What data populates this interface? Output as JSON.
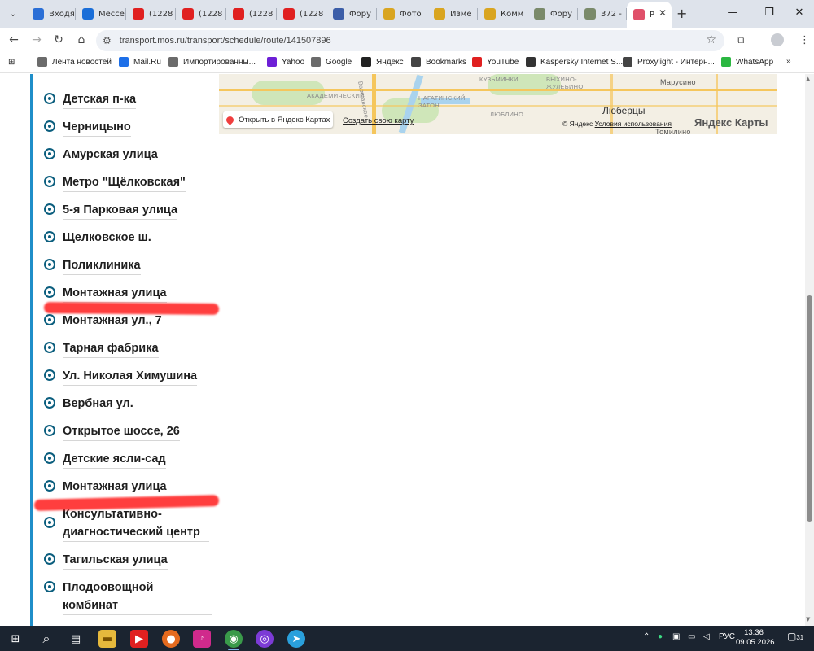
{
  "tabs": [
    {
      "label": "Входя",
      "favicon": "mail-icon",
      "color": "#2b6fd6"
    },
    {
      "label": "Мессе",
      "favicon": "messenger-icon",
      "color": "#1a6ed8"
    },
    {
      "label": "(1228",
      "favicon": "youtube-icon",
      "color": "#e02020"
    },
    {
      "label": "(1228",
      "favicon": "youtube-icon",
      "color": "#e02020"
    },
    {
      "label": "(1228",
      "favicon": "youtube-icon",
      "color": "#e02020"
    },
    {
      "label": "(1228",
      "favicon": "youtube-icon",
      "color": "#e02020"
    },
    {
      "label": "Фору",
      "favicon": "forum-icon",
      "color": "#3c5ea8"
    },
    {
      "label": "Фото",
      "favicon": "letter-a-icon",
      "color": "#d9a520"
    },
    {
      "label": "Изме",
      "favicon": "letter-a-icon",
      "color": "#d9a520"
    },
    {
      "label": "Комм",
      "favicon": "letter-a-icon",
      "color": "#d9a520"
    },
    {
      "label": "Фору",
      "favicon": "image-icon",
      "color": "#7a8a6a"
    },
    {
      "label": "372 -",
      "favicon": "image-icon",
      "color": "#7a8a6a"
    },
    {
      "label": "Р",
      "favicon": "transport-icon",
      "color": "#e0506a",
      "active": true
    }
  ],
  "window_controls": {
    "minimize": "—",
    "restore": "❐",
    "close": "✕"
  },
  "address": {
    "url": "transport.mos.ru/transport/schedule/route/141507896"
  },
  "bookmarks": [
    {
      "label": "Лента новостей",
      "icon": "folder-icon"
    },
    {
      "label": "Mail.Ru",
      "icon": "mailru-icon"
    },
    {
      "label": "Импортированны...",
      "icon": "folder-icon"
    },
    {
      "label": "Yahoo",
      "icon": "yahoo-icon"
    },
    {
      "label": "Google",
      "icon": "folder-icon"
    },
    {
      "label": "Яндекс",
      "icon": "yandex-icon"
    },
    {
      "label": "Bookmarks",
      "icon": "star-icon"
    },
    {
      "label": "YouTube",
      "icon": "youtube-icon"
    },
    {
      "label": "Kaspersky Internet S...",
      "icon": "kaspersky-icon"
    },
    {
      "label": "Proxylight - Интерн...",
      "icon": "proxy-icon"
    },
    {
      "label": "WhatsApp",
      "icon": "whatsapp-icon"
    }
  ],
  "stops": [
    "Детская п-ка",
    "Черницыно",
    "Амурская улица",
    "Метро \"Щёлковская\"",
    "5-я Парковая улица",
    "Щелковское ш.",
    "Поликлиника",
    "Монтажная улица",
    "Монтажная ул., 7",
    "Тарная фабрика",
    "Ул. Николая Химушина",
    "Вербная ул.",
    "Открытое шоссе, 26",
    "Детские ясли-сад",
    "Монтажная улица",
    "Консультативно-диагностический центр",
    "Тагильская улица",
    "Плодоовощной комбинат"
  ],
  "map": {
    "open_button": "Открыть в Яндекс Картах",
    "create_link": "Создать свою карту",
    "copyright": "© Яндекс",
    "terms": "Условия использования",
    "brand": "Яндекс Карты",
    "city": "Люберцы",
    "labels": [
      "АКАДЕМИЧЕСКИЙ",
      "НАГАТИНСКИЙ ЗАТОН",
      "КУЗЬМИНКИ",
      "ВЫХИНО-ЖУЛЕБИНО",
      "ЛЮБЛИНО",
      "Марусино",
      "Томилино",
      "Варшавское"
    ]
  },
  "clock": {
    "time": "13:36",
    "date": "09.05.2026"
  },
  "tray": {
    "lang": "РУС",
    "notifications": "31"
  }
}
